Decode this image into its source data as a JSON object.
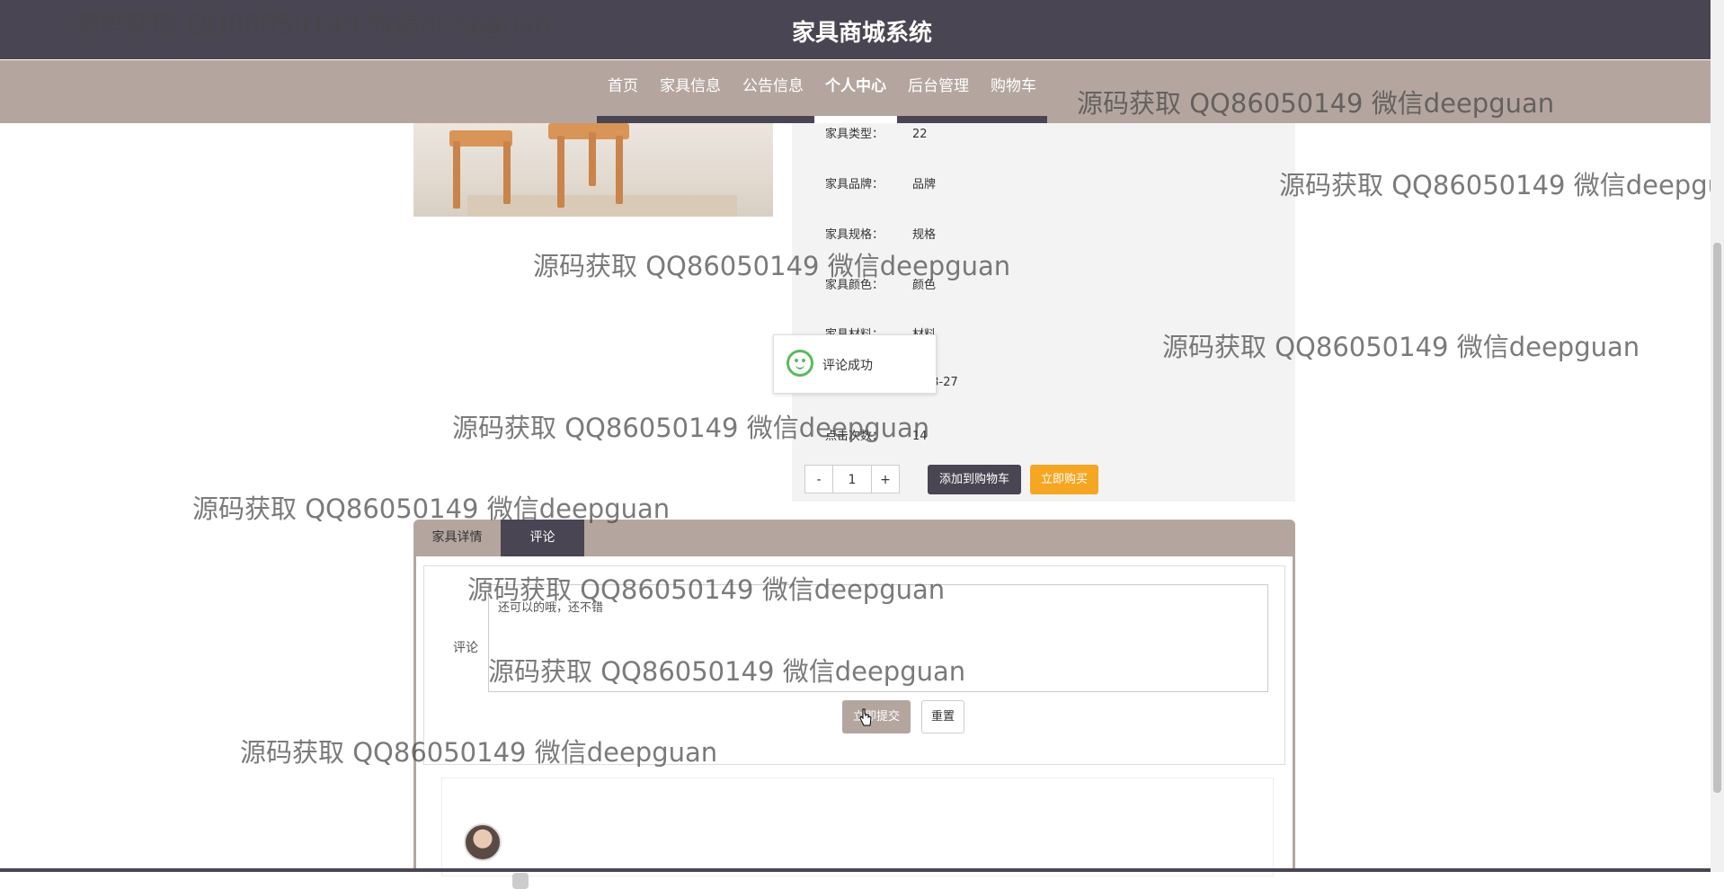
{
  "header": {
    "title": "家具商城系统"
  },
  "nav": {
    "items": [
      {
        "label": "首页"
      },
      {
        "label": "家具信息"
      },
      {
        "label": "公告信息"
      },
      {
        "label": "个人中心"
      },
      {
        "label": "后台管理"
      },
      {
        "label": "购物车"
      }
    ],
    "active": "个人中心"
  },
  "product": {
    "info": [
      {
        "label": "家具类型：",
        "value": "22"
      },
      {
        "label": "家具品牌：",
        "value": "品牌"
      },
      {
        "label": "家具规格：",
        "value": "规格"
      },
      {
        "label": "家具颜色：",
        "value": "颜色"
      },
      {
        "label": "家具材料：",
        "value": "材料"
      },
      {
        "label": "",
        "value": "2-03-27"
      },
      {
        "label": "点击次数：",
        "value": "14"
      }
    ],
    "quantity": {
      "minus": "-",
      "value": "1",
      "plus": "+"
    },
    "add_to_cart": "添加到购物车",
    "buy_now": "立即购买"
  },
  "toast": {
    "message": "评论成功"
  },
  "tabs": [
    {
      "label": "家具详情"
    },
    {
      "label": "评论"
    }
  ],
  "comment": {
    "label": "评论",
    "text": "还可以的哦，还不错",
    "submit": "立即提交",
    "reset": "重置"
  },
  "watermark": "源码获取 QQ86050149 微信deepguan",
  "colors": {
    "header": "#4a4552",
    "nav": "#b4a69f",
    "buy": "#f5a623",
    "success": "#5cb85c"
  }
}
